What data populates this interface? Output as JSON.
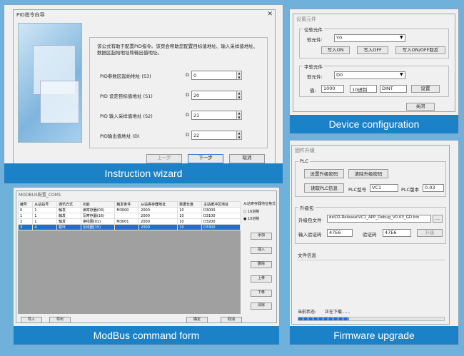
{
  "wizard": {
    "window_title": "PID指令向导",
    "description": "该公式有助于配置PID指令。该页会帮助您配置目标值地址、输入采样值地址、数据区起始地址和输出值地址。",
    "fields": [
      {
        "label": "PID参数区起始地址 (S3)",
        "prefix": "D",
        "value": "0"
      },
      {
        "label": "PID 设定目标值地址 (S1)",
        "prefix": "D",
        "value": "20"
      },
      {
        "label": "PID 输入采样值地址 (S2)",
        "prefix": "D",
        "value": "21"
      },
      {
        "label": "PID输出值地址 (D)",
        "prefix": "D",
        "value": "22"
      }
    ],
    "prev_button": "上一步",
    "next_button": "下一步",
    "cancel_button": "取消",
    "caption": "Instruction wizard"
  },
  "device": {
    "window_title": "设置元件",
    "bit_group_title": "位软元件",
    "bit_label": "软元件:",
    "bit_value": "Y0",
    "bit_buttons": [
      "写入ON",
      "写入OFF",
      "写入ON/OFF取反"
    ],
    "word_group_title": "字软元件",
    "word_label": "软元件:",
    "word_value": "D0",
    "value_label": "值:",
    "value": "1000",
    "radix": "10进制",
    "data_type": "DINT",
    "set_button": "设置",
    "close_button": "关闭",
    "caption": "Device configuration"
  },
  "modbus": {
    "window_title": "MODBUS配置_COM1",
    "columns": [
      "编号",
      "从站站号",
      "通讯方式",
      "功能",
      "触发条件",
      "从站寄存器地址",
      "数据长度",
      "主站缓冲区地址"
    ],
    "rows": [
      [
        "0",
        "1",
        "触发",
        "读寄存器(03)",
        "M3000",
        "2000",
        "10",
        "D3000"
      ],
      [
        "1",
        "1",
        "触发",
        "写寄存器(16)",
        "",
        "2000",
        "10",
        "D3100"
      ],
      [
        "2",
        "1",
        "触发",
        "读线圈(01)",
        "M3001",
        "2000",
        "10",
        "D3200"
      ],
      [
        "3",
        "4",
        "循环",
        "写线圈(15)",
        "",
        "2000",
        "10",
        "D3300"
      ]
    ],
    "selected_row": 3,
    "format_title": "从站寄存器地址格式",
    "radio_options": [
      "16进制",
      "10进制"
    ],
    "selected_radio": 1,
    "side_buttons": [
      "添加",
      "插入",
      "删除",
      "上移",
      "下移",
      "清除"
    ],
    "import_button": "导入",
    "export_button": "导出",
    "ok_button": "确定",
    "cancel_button": "取消",
    "caption": "ModBus command form"
  },
  "firmware": {
    "window_title": "固件升级",
    "plc_group": "PLC",
    "set_upgrade_pwd": "设置升级密码",
    "clear_upgrade_pwd": "清除升级密码",
    "read_plc_info": "读取PLC信息",
    "plc_model_label": "PLC型号",
    "plc_model": "VC1",
    "plc_version_label": "PLC版本",
    "plc_version": "0.03",
    "pkg_group": "升级包",
    "pkg_file_label": "升级包文件",
    "pkg_file": "de\\02-Release\\VC1_APP_Debug_V0.03_GD.bin",
    "browse": "...",
    "input_code_label": "输入验证码",
    "input_code": "47E6",
    "verify_code_label": "验证码",
    "verify_code": "47E6",
    "upgrade_button": "升级",
    "file_info_label": "文件信息",
    "status_label": "当前状态:",
    "status_text": "正在下载......",
    "progress": 0.35,
    "caption": "Firmware upgrade"
  }
}
